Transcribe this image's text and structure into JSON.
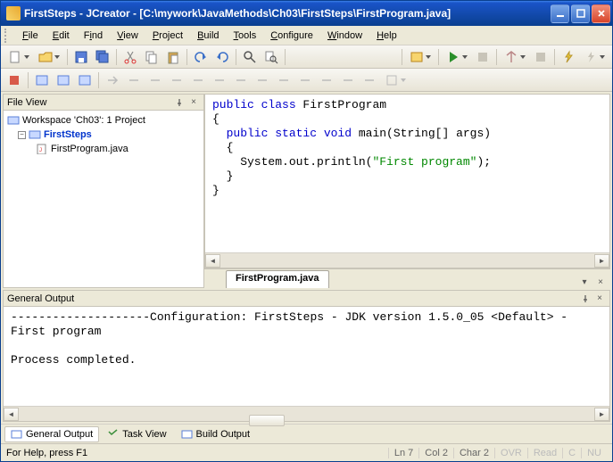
{
  "title": "FirstSteps - JCreator - [C:\\mywork\\JavaMethods\\Ch03\\FirstSteps\\FirstProgram.java]",
  "menu": {
    "file": "File",
    "edit": "Edit",
    "find": "Find",
    "view": "View",
    "project": "Project",
    "build": "Build",
    "tools": "Tools",
    "configure": "Configure",
    "window": "Window",
    "help": "Help"
  },
  "fileview": {
    "title": "File View",
    "workspace": "Workspace 'Ch03': 1 Project",
    "project": "FirstSteps",
    "file": "FirstProgram.java"
  },
  "editor": {
    "tab": "FirstProgram.java",
    "code": {
      "l1a": "public",
      "l1b": " class",
      "l1c": " FirstProgram",
      "l2": "{",
      "l3a": "  public",
      "l3b": " static",
      "l3c": " void",
      "l3d": " main(String[] args)",
      "l4": "  {",
      "l5a": "    System.out.println(",
      "l5b": "\"First program\"",
      "l5c": ");",
      "l6": "  }",
      "l7": "}"
    }
  },
  "output": {
    "title": "General Output",
    "line1": "--------------------Configuration: FirstSteps - JDK version 1.5.0_05 <Default> -",
    "line2": "First program",
    "line3": "",
    "line4": "Process completed."
  },
  "bottomtabs": {
    "general": "General Output",
    "task": "Task View",
    "build": "Build Output"
  },
  "status": {
    "help": "For Help, press F1",
    "ln": "Ln 7",
    "col": "Col 2",
    "char": "Char 2",
    "ovr": "OVR",
    "read": "Read",
    "c": "C",
    "num": "NU"
  }
}
